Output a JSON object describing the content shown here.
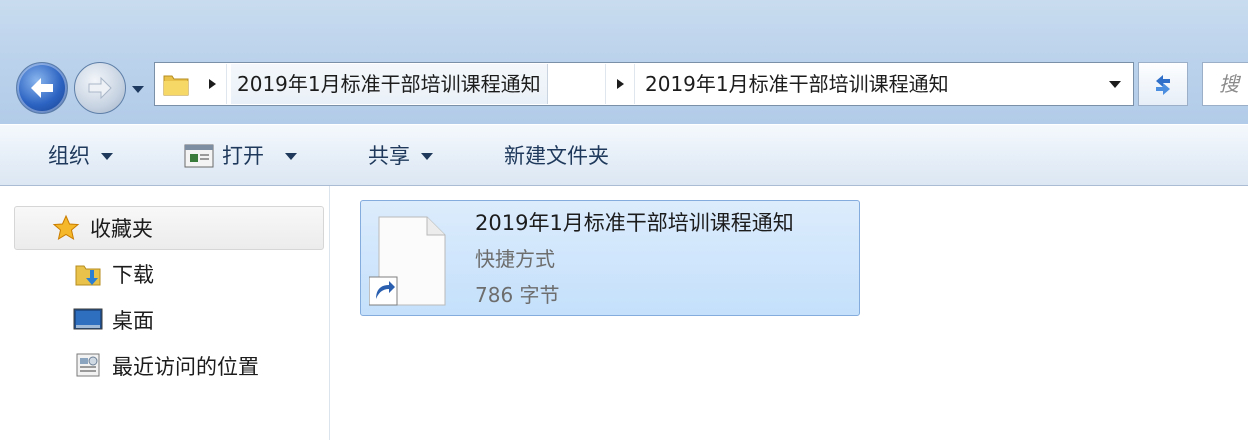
{
  "address": {
    "crumbs": [
      "2019年1月标准干部培训课程通知",
      "2019年1月标准干部培训课程通知"
    ]
  },
  "search": {
    "placeholder": "搜"
  },
  "toolbar": {
    "organize": "组织",
    "open": "打开",
    "share": "共享",
    "new_folder": "新建文件夹"
  },
  "nav": {
    "favorites": "收藏夹",
    "items": [
      {
        "label": "下载",
        "icon": "downloads-folder-icon"
      },
      {
        "label": "桌面",
        "icon": "desktop-icon"
      },
      {
        "label": "最近访问的位置",
        "icon": "recent-places-icon"
      }
    ]
  },
  "files": [
    {
      "name": "2019年1月标准干部培训课程通知",
      "type": "快捷方式",
      "size": "786 字节",
      "icon": "shortcut-file-icon"
    }
  ],
  "colors": {
    "selection": "#cce4fb",
    "selection_border": "#84acdd",
    "accent": "#2c63c2"
  }
}
